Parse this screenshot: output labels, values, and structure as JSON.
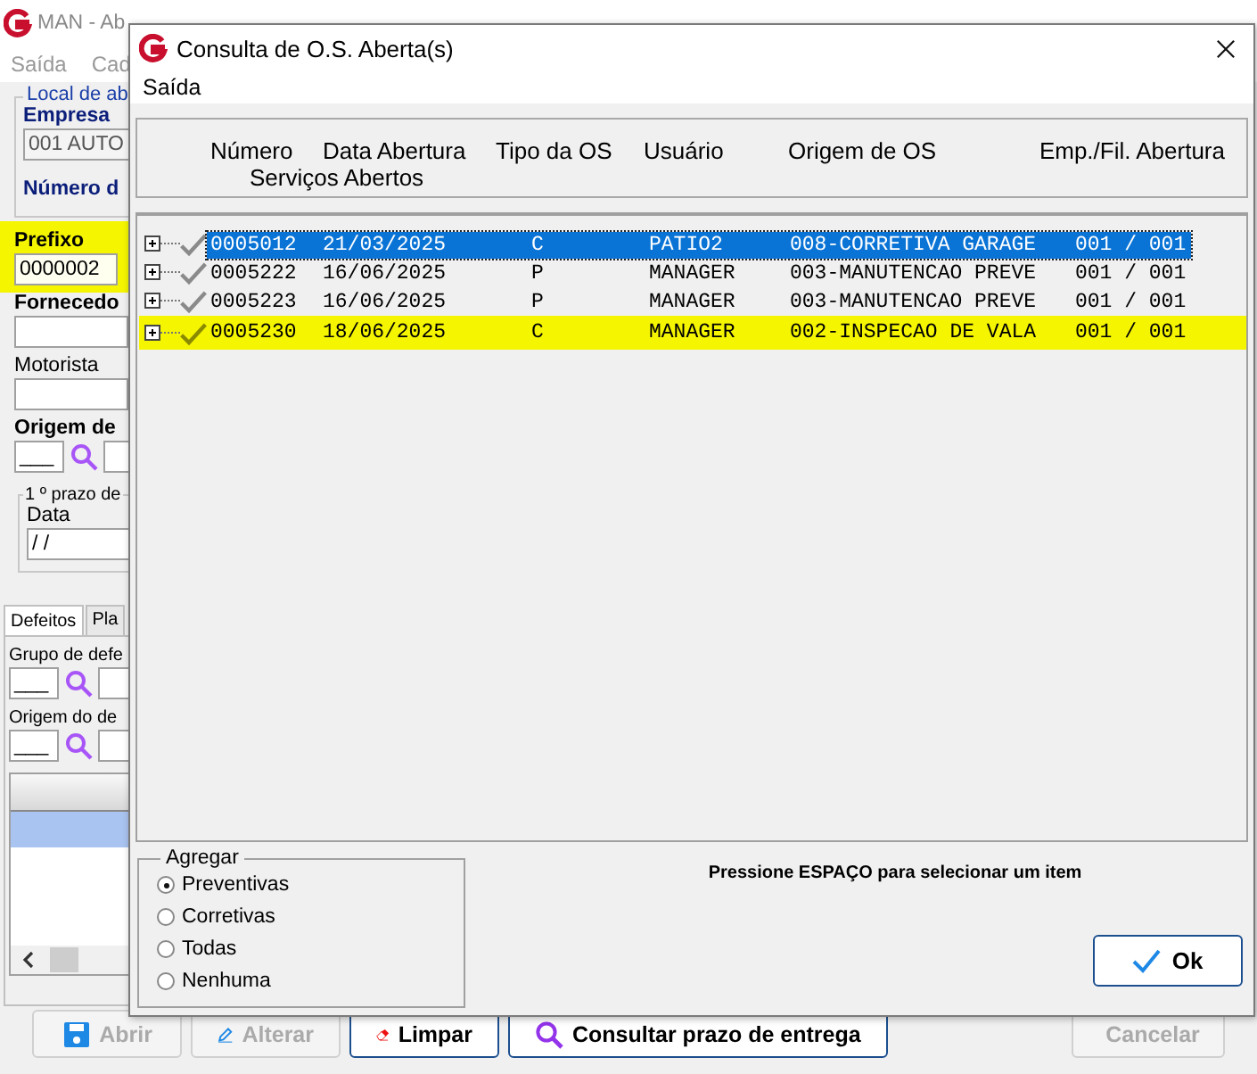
{
  "background_window": {
    "title": "MAN - Ab",
    "menu": [
      "Saída",
      "Cad"
    ],
    "local_group": {
      "title": "Local de ab",
      "empresa_label": "Empresa",
      "empresa_value": "001 AUTO",
      "numero_label": "Número d"
    },
    "prefixo": {
      "label": "Prefixo",
      "value": "0000002",
      "highlighted": true
    },
    "fornecedor_label": "Fornecedo",
    "motorista_label": "Motorista",
    "origem_label": "Origem de",
    "origem_value": "___",
    "prazo_group": {
      "title": "1 º prazo de",
      "data_label": "Data",
      "data_value": " / /"
    },
    "tabs": [
      {
        "label": "Defeitos",
        "selected": true
      },
      {
        "label": "Pla",
        "selected": false
      }
    ],
    "grupo_label": "Grupo de defe",
    "grupo_value": "___",
    "origem_defeito_label": "Origem do de",
    "origem_defeito_value": "___",
    "buttons": [
      {
        "label": "Abrir",
        "disabled": true
      },
      {
        "label": "Alterar",
        "disabled": true
      },
      {
        "label": "Limpar",
        "disabled": false
      },
      {
        "label": "Consultar prazo de entrega",
        "disabled": false
      },
      {
        "label": "Cancelar",
        "disabled": true
      }
    ]
  },
  "dialog": {
    "title": "Consulta de O.S. Aberta(s)",
    "menu": [
      "Saída"
    ],
    "columns": [
      "Número",
      "Data Abertura",
      "Tipo da OS",
      "Usuário",
      "Origem de OS",
      "Emp./Fil. Abertura"
    ],
    "columns_line2": "Serviços Abertos",
    "rows": [
      {
        "numero": "0005012",
        "data": "21/03/2025",
        "tipo": "C",
        "usuario": "PATIO2",
        "origem": "008-CORRETIVA GARAGE",
        "emp": "001 / 001",
        "selected": true,
        "highlighted": false
      },
      {
        "numero": "0005222",
        "data": "16/06/2025",
        "tipo": "P",
        "usuario": "MANAGER",
        "origem": "003-MANUTENCAO PREVE",
        "emp": "001 / 001",
        "selected": false,
        "highlighted": false
      },
      {
        "numero": "0005223",
        "data": "16/06/2025",
        "tipo": "P",
        "usuario": "MANAGER",
        "origem": "003-MANUTENCAO PREVE",
        "emp": "001 / 001",
        "selected": false,
        "highlighted": false
      },
      {
        "numero": "0005230",
        "data": "18/06/2025",
        "tipo": "C",
        "usuario": "MANAGER",
        "origem": "002-INSPECAO DE VALA",
        "emp": "001 / 001",
        "selected": false,
        "highlighted": true
      }
    ],
    "agregar": {
      "title": "Agregar",
      "options": [
        {
          "label": "Preventivas",
          "selected": true
        },
        {
          "label": "Corretivas",
          "selected": false
        },
        {
          "label": "Todas",
          "selected": false
        },
        {
          "label": "Nenhuma",
          "selected": false
        }
      ]
    },
    "hint": "Pressione ESPAÇO para selecionar um item",
    "ok_button": "Ok"
  }
}
